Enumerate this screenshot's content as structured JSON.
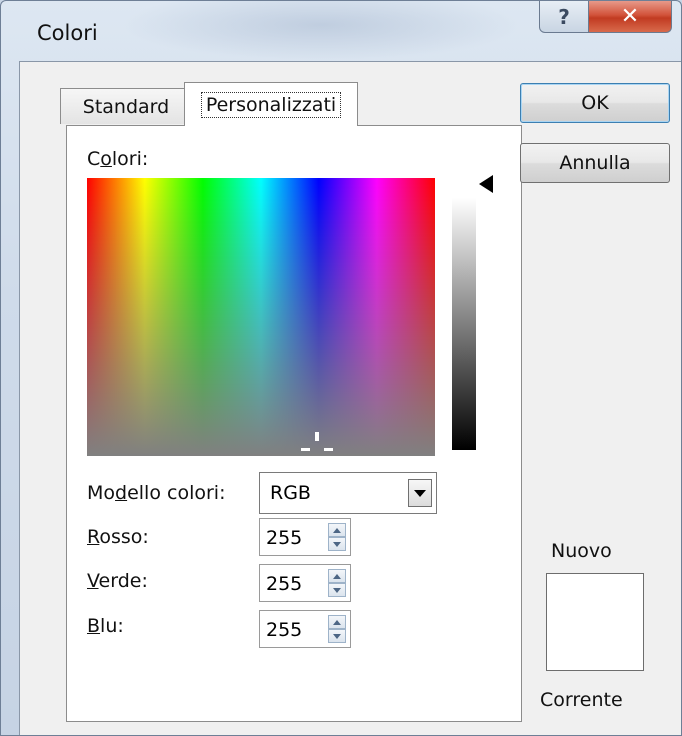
{
  "window": {
    "title": "Colori",
    "help_glyph": "?",
    "close_glyph": "✕"
  },
  "tabs": [
    {
      "label": "Standard",
      "selected": false
    },
    {
      "label": "Personalizzati",
      "selected": true
    }
  ],
  "custom": {
    "colors_label_pre": "C",
    "colors_label_ul": "o",
    "colors_label_post": "lori:",
    "model_label_pre": "Mo",
    "model_label_ul": "d",
    "model_label_post": "ello colori:",
    "model_value": "RGB",
    "red_label_ul": "R",
    "red_label_post": "osso:",
    "red_value": "255",
    "green_label_ul": "V",
    "green_label_post": "erde:",
    "green_value": "255",
    "blue_label_ul": "B",
    "blue_label_post": "lu:",
    "blue_value": "255"
  },
  "buttons": {
    "ok": "OK",
    "cancel": "Annulla"
  },
  "preview": {
    "new_label": "Nuovo",
    "current_label": "Corrente",
    "new_color": "#ffffff",
    "current_color": "#ffffff"
  },
  "icons": {
    "help": "help-icon",
    "close": "close-icon",
    "dropdown": "chevron-down-icon",
    "spin_up": "spin-up-icon",
    "spin_down": "spin-down-icon",
    "luminance_pointer": "triangle-left-icon"
  }
}
